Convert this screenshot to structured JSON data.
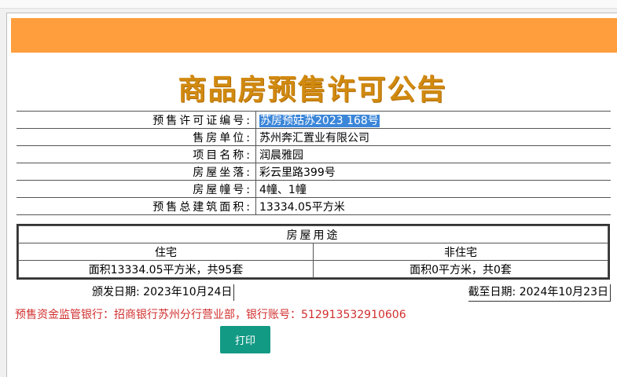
{
  "title": "商品房预售许可公告",
  "info_rows": [
    {
      "label": "预售许可证编号:",
      "value": "苏房预姑苏2023 168号"
    },
    {
      "label": "售房单位:",
      "value": "苏州奔汇置业有限公司"
    },
    {
      "label": "项目名称:",
      "value": "润晨雅园"
    },
    {
      "label": "房屋坐落:",
      "value": "彩云里路399号"
    },
    {
      "label": "房屋幢号:",
      "value": "4幢、1幢"
    },
    {
      "label": "预售总建筑面积:",
      "value": "13334.05平方米"
    }
  ],
  "usage": {
    "header": "房屋用途",
    "columns": [
      "住宅",
      "非住宅"
    ],
    "values": [
      "面积13334.05平方米，共95套",
      "面积0平方米，共0套"
    ]
  },
  "issue_date": "颁发日期:  2023年10月24日",
  "expiry_date": "截至日期:  2024年10月23日",
  "bank_info": "预售资金监管银行：招商银行苏州分行营业部，银行账号：512913532910606",
  "print_label": "打印",
  "colors": {
    "banner": "#ff9e3d",
    "title": "#d18a10",
    "bank_text": "#d12f2f",
    "print_button": "#139a85",
    "selection": "#3b86d9"
  }
}
